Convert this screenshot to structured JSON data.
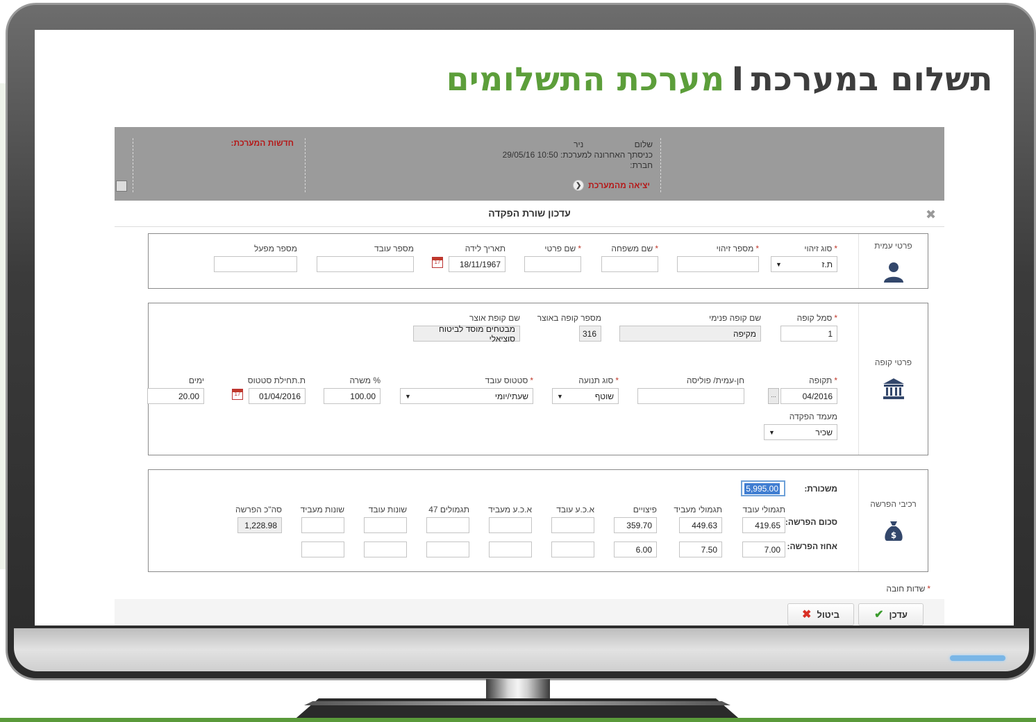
{
  "headline": {
    "part1": "תשלום במערכת",
    "separator": "I",
    "part2": "מערכת התשלומים"
  },
  "header": {
    "greeting": "שלום",
    "user_name": "ניר",
    "last_login_label": "כניסתך האחרונה למערכת:",
    "last_login_value": "29/05/16 10:50",
    "company_label": "חברת:",
    "logout_label": "יציאה מהמערכת",
    "news_label": "חדשות המערכת:"
  },
  "dialog": {
    "title": "עדכון שורת הפקדה"
  },
  "employee": {
    "section_label": "פרטי עמית",
    "id_type_label": "סוג זיהוי",
    "id_type_value": "ת.ז",
    "id_number_label": "מספר זיהוי",
    "id_number_value": "",
    "last_name_label": "שם משפחה",
    "last_name_value": "",
    "first_name_label": "שם פרטי",
    "first_name_value": "",
    "birth_date_label": "תאריך לידה",
    "birth_date_value": "18/11/1967",
    "employee_number_label": "מספר עובד",
    "employee_number_value": "",
    "plant_number_label": "מספר מפעל",
    "plant_number_value": ""
  },
  "fund": {
    "section_label": "פרטי קופה",
    "fund_code_label": "סמל קופה",
    "fund_code_value": "1",
    "internal_name_label": "שם קופה פנימי",
    "internal_name_value": "מקיפה",
    "treasury_number_label": "מספר קופה באוצר",
    "treasury_number_value": "316",
    "treasury_name_label": "שם קופת אוצר",
    "treasury_name_value": "מבטחים מוסד לביטוח סוציאלי",
    "period_label": "תקופה",
    "period_value": "04/2016",
    "account_label": "חן-עמית/ פוליסה",
    "account_value": "",
    "movement_type_label": "סוג תנועה",
    "movement_type_value": "שוטף",
    "employee_status_label": "סטטוס עובד",
    "employee_status_value": "שעתי/יומי",
    "job_percent_label": "% משרה",
    "job_percent_value": "100.00",
    "status_start_label": "ת.תחילת סטטוס",
    "status_start_value": "01/04/2016",
    "days_label": "ימים",
    "days_value": "20.00",
    "deposit_status_label": "מעמד הפקדה",
    "deposit_status_value": "שכיר"
  },
  "deposit": {
    "section_label": "רכיבי הפרשה",
    "salary_label": "משכורת:",
    "salary_value": "5,995.00",
    "amount_row_label": "סכום הפרשה:",
    "percent_row_label": "אחוז הפרשה:",
    "columns": [
      {
        "label": "תגמולי עובד",
        "amount": "419.65",
        "percent": "7.00"
      },
      {
        "label": "תגמולי מעביד",
        "amount": "449.63",
        "percent": "7.50"
      },
      {
        "label": "פיצויים",
        "amount": "359.70",
        "percent": "6.00"
      },
      {
        "label": "א.כ.ע עובד",
        "amount": "",
        "percent": ""
      },
      {
        "label": "א.כ.ע מעביד",
        "amount": "",
        "percent": ""
      },
      {
        "label": "תגמולים 47",
        "amount": "",
        "percent": ""
      },
      {
        "label": "שונות עובד",
        "amount": "",
        "percent": ""
      },
      {
        "label": "שונות מעביד",
        "amount": "",
        "percent": ""
      }
    ],
    "total_label": "סה\"כ הפרשה",
    "total_value": "1,228.98"
  },
  "mandatory_note": "שדות חובה",
  "buttons": {
    "update": "עדכן",
    "cancel": "ביטול"
  },
  "icons": {
    "user": "user-icon",
    "bank": "bank-icon",
    "money_bag": "money-bag-icon",
    "calendar": "calendar-icon",
    "close": "close-icon",
    "check": "check-icon",
    "x": "x-icon"
  },
  "colors": {
    "headline_green": "#5c9e3a",
    "headline_dark": "#3d3d3d",
    "header_gray": "#9b9b9b",
    "link_red": "#b41a1a",
    "icon_navy": "#33476b",
    "required_red": "#c0392b"
  }
}
